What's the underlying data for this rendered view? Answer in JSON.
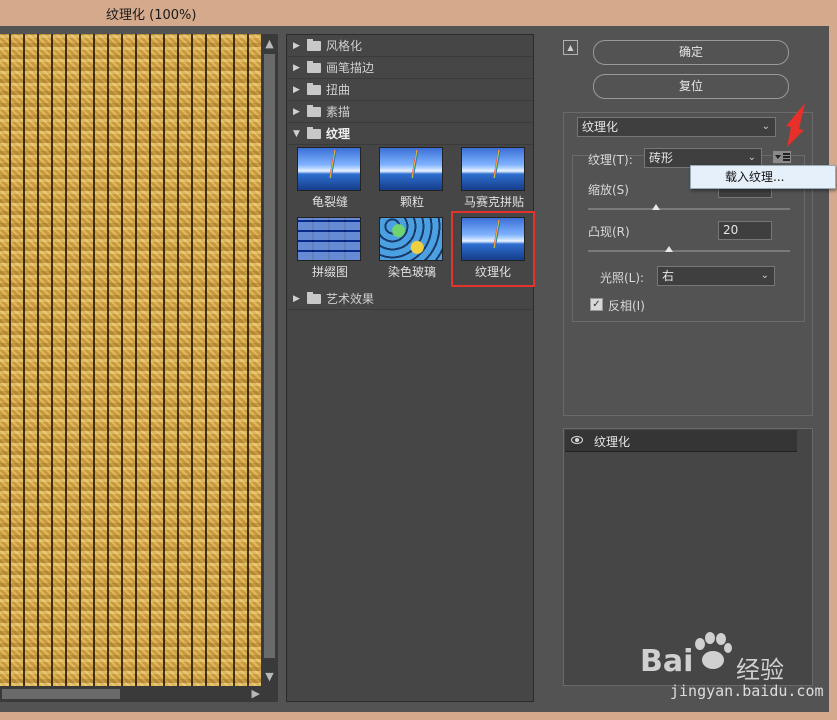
{
  "window": {
    "title": "纹理化 (100%)"
  },
  "gallery": {
    "categories": [
      {
        "label": "风格化"
      },
      {
        "label": "画笔描边"
      },
      {
        "label": "扭曲"
      },
      {
        "label": "素描"
      },
      {
        "label": "纹理"
      },
      {
        "label": "艺术效果"
      }
    ],
    "thumbnails": [
      {
        "label": "龟裂缝"
      },
      {
        "label": "颗粒"
      },
      {
        "label": "马赛克拼贴"
      },
      {
        "label": "拼缀图"
      },
      {
        "label": "染色玻璃"
      },
      {
        "label": "纹理化"
      }
    ]
  },
  "buttons": {
    "ok": "确定",
    "reset": "复位"
  },
  "settings": {
    "filter_select": "纹理化",
    "texture": {
      "label": "纹理(T):",
      "value": "砖形"
    },
    "scale": {
      "label": "缩放(S)"
    },
    "relief": {
      "label": "凸现(R)",
      "value": "20"
    },
    "light": {
      "label": "光照(L):",
      "value": "右"
    },
    "invert": {
      "label": "反相(I)",
      "checked": true
    }
  },
  "context_menu": {
    "load_texture": "载入纹理..."
  },
  "layers": {
    "items": [
      {
        "name": "纹理化"
      }
    ]
  },
  "watermark": {
    "brand": "Bai",
    "brand_suffix": "经验",
    "url": "jingyan.baidu.com"
  },
  "colors": {
    "selection_border": "#e3332d",
    "annotation_arrow": "#e8302a",
    "panel_bg": "#535353"
  }
}
